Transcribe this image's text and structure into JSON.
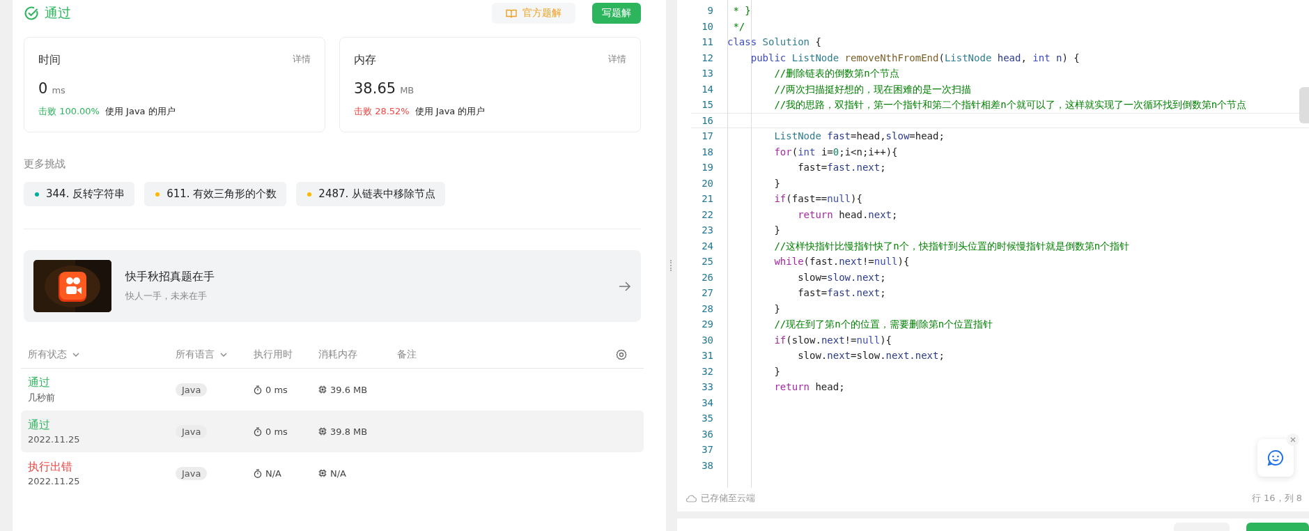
{
  "result": {
    "status": "通过",
    "solution_button": "官方题解",
    "write_button": "写题解"
  },
  "stats": [
    {
      "title": "时间",
      "detail": "详情",
      "value": "0",
      "unit": "ms",
      "beat": "击败 100.00%",
      "color": "#2db55d",
      "users": "使用 Java 的用户"
    },
    {
      "title": "内存",
      "detail": "详情",
      "value": "38.65",
      "unit": "MB",
      "beat": "击败 28.52%",
      "color": "#ef4743",
      "users": "使用 Java 的用户"
    }
  ],
  "more": {
    "title": "更多挑战",
    "items": [
      {
        "label": "344. 反转字符串",
        "color": "#00af9b"
      },
      {
        "label": "611. 有效三角形的个数",
        "color": "#ffb800"
      },
      {
        "label": "2487. 从链表中移除节点",
        "color": "#ffb800"
      }
    ]
  },
  "banner": {
    "kind": "picture",
    "title": "快手秋招真题在手",
    "subtitle": "快人一手，未来在手"
  },
  "table": {
    "columns": [
      "所有状态",
      "所有语言",
      "执行用时",
      "消耗内存",
      "备注"
    ],
    "rows": [
      {
        "status": "通过",
        "color": "#2db55d",
        "date": "几秒前",
        "language": "Java",
        "runtime": "0 ms",
        "memory": "39.6 MB",
        "highlighted": false
      },
      {
        "status": "通过",
        "color": "#2db55d",
        "date": "2022.11.25",
        "language": "Java",
        "runtime": "0 ms",
        "memory": "39.8 MB",
        "highlighted": true
      },
      {
        "status": "执行出错",
        "color": "#ef4743",
        "date": "2022.11.25",
        "language": "Java",
        "runtime": "N/A",
        "memory": "N/A",
        "highlighted": false
      }
    ]
  },
  "editor": {
    "lines": [
      {
        "number": "9",
        "current": false,
        "tokens": [
          {
            "kind": "comment",
            "text": " * }"
          }
        ]
      },
      {
        "number": "10",
        "current": false,
        "tokens": [
          {
            "kind": "comment",
            "text": " */"
          }
        ]
      },
      {
        "number": "11",
        "current": false,
        "tokens": [
          {
            "kind": "decl",
            "text": "class"
          },
          {
            "kind": "type",
            "text": " Solution"
          },
          {
            "kind": "plain",
            "text": " {"
          }
        ]
      },
      {
        "number": "12",
        "current": false,
        "tokens": [
          {
            "kind": "decl",
            "text": "    public"
          },
          {
            "kind": "type",
            "text": " ListNode"
          },
          {
            "kind": "fn",
            "text": " removeNthFromEnd"
          },
          {
            "kind": "plain",
            "text": "("
          },
          {
            "kind": "type",
            "text": "ListNode"
          },
          {
            "kind": "var",
            "text": " head"
          },
          {
            "kind": "plain",
            "text": ", "
          },
          {
            "kind": "decl",
            "text": "int"
          },
          {
            "kind": "var",
            "text": " n"
          },
          {
            "kind": "plain",
            "text": ") {"
          }
        ]
      },
      {
        "number": "13",
        "current": false,
        "tokens": [
          {
            "kind": "comment",
            "text": "        //删除链表的倒数第n个节点"
          }
        ]
      },
      {
        "number": "14",
        "current": false,
        "tokens": [
          {
            "kind": "comment",
            "text": "        //两次扫描挺好想的，现在困难的是一次扫描"
          }
        ]
      },
      {
        "number": "15",
        "current": false,
        "tokens": [
          {
            "kind": "comment",
            "text": "        //我的思路，双指针，第一个指针和第二个指针相差n个就可以了，这样就实现了一次循环找到倒数第n个节点"
          }
        ]
      },
      {
        "number": "16",
        "current": true
      },
      {
        "number": "17",
        "current": false,
        "tokens": [
          {
            "kind": "type",
            "text": "        ListNode"
          },
          {
            "kind": "var",
            "text": " fast"
          },
          {
            "kind": "plain",
            "text": "=head,"
          },
          {
            "kind": "var",
            "text": "slow"
          },
          {
            "kind": "plain",
            "text": "=head;"
          }
        ]
      },
      {
        "number": "18",
        "current": false,
        "tokens": [
          {
            "kind": "kw",
            "text": "        for"
          },
          {
            "kind": "plain",
            "text": "("
          },
          {
            "kind": "decl",
            "text": "int"
          },
          {
            "kind": "plain",
            "text": " i="
          },
          {
            "kind": "num",
            "text": "0"
          },
          {
            "kind": "plain",
            "text": ";i<n;i++){"
          }
        ]
      },
      {
        "number": "19",
        "current": false,
        "tokens": [
          {
            "kind": "plain",
            "text": "            fast="
          },
          {
            "kind": "var",
            "text": "fast.next"
          },
          {
            "kind": "plain",
            "text": ";"
          }
        ]
      },
      {
        "number": "20",
        "current": false,
        "tokens": [
          {
            "kind": "plain",
            "text": "        }"
          }
        ]
      },
      {
        "number": "21",
        "current": false,
        "tokens": [
          {
            "kind": "kw",
            "text": "        if"
          },
          {
            "kind": "plain",
            "text": "(fast=="
          },
          {
            "kind": "decl",
            "text": "null"
          },
          {
            "kind": "plain",
            "text": "){"
          }
        ]
      },
      {
        "number": "22",
        "current": false,
        "tokens": [
          {
            "kind": "kw",
            "text": "            return"
          },
          {
            "kind": "plain",
            "text": " head."
          },
          {
            "kind": "var",
            "text": "next"
          },
          {
            "kind": "plain",
            "text": ";"
          }
        ]
      },
      {
        "number": "23",
        "current": false,
        "tokens": [
          {
            "kind": "plain",
            "text": "        }"
          }
        ]
      },
      {
        "number": "24",
        "current": false,
        "tokens": [
          {
            "kind": "comment",
            "text": "        //这样快指针比慢指针快了n个，快指针到头位置的时候慢指针就是倒数第n个指针"
          }
        ]
      },
      {
        "number": "25",
        "current": false,
        "tokens": [
          {
            "kind": "kw",
            "text": "        while"
          },
          {
            "kind": "plain",
            "text": "(fast."
          },
          {
            "kind": "var",
            "text": "next"
          },
          {
            "kind": "plain",
            "text": "!="
          },
          {
            "kind": "decl",
            "text": "null"
          },
          {
            "kind": "plain",
            "text": "){"
          }
        ]
      },
      {
        "number": "26",
        "current": false,
        "tokens": [
          {
            "kind": "plain",
            "text": "            slow="
          },
          {
            "kind": "var",
            "text": "slow.next"
          },
          {
            "kind": "plain",
            "text": ";"
          }
        ]
      },
      {
        "number": "27",
        "current": false,
        "tokens": [
          {
            "kind": "plain",
            "text": "            fast="
          },
          {
            "kind": "var",
            "text": "fast.next"
          },
          {
            "kind": "plain",
            "text": ";"
          }
        ]
      },
      {
        "number": "28",
        "current": false,
        "tokens": [
          {
            "kind": "plain",
            "text": "        }"
          }
        ]
      },
      {
        "number": "29",
        "current": false,
        "tokens": [
          {
            "kind": "comment",
            "text": "        //现在到了第n个的位置，需要删除第n个位置指针"
          }
        ]
      },
      {
        "number": "30",
        "current": false,
        "tokens": [
          {
            "kind": "kw",
            "text": "        if"
          },
          {
            "kind": "plain",
            "text": "(slow."
          },
          {
            "kind": "var",
            "text": "next"
          },
          {
            "kind": "plain",
            "text": "!="
          },
          {
            "kind": "decl",
            "text": "null"
          },
          {
            "kind": "plain",
            "text": "){"
          }
        ]
      },
      {
        "number": "31",
        "current": false,
        "tokens": [
          {
            "kind": "plain",
            "text": "            slow."
          },
          {
            "kind": "var",
            "text": "next"
          },
          {
            "kind": "plain",
            "text": "=slow."
          },
          {
            "kind": "var",
            "text": "next.next"
          },
          {
            "kind": "plain",
            "text": ";"
          }
        ]
      },
      {
        "number": "32",
        "current": false,
        "tokens": [
          {
            "kind": "plain",
            "text": "        }"
          }
        ]
      },
      {
        "number": "33",
        "current": false,
        "tokens": [
          {
            "kind": "kw",
            "text": "        return"
          },
          {
            "kind": "plain",
            "text": " head;"
          }
        ]
      },
      {
        "number": "34",
        "current": false
      },
      {
        "number": "35",
        "current": false
      },
      {
        "number": "36",
        "current": false
      },
      {
        "number": "37",
        "current": false
      },
      {
        "number": "38",
        "current": false
      }
    ],
    "status_bar": {
      "saved": "已存储至云端",
      "position": "行 16，列 8"
    }
  }
}
